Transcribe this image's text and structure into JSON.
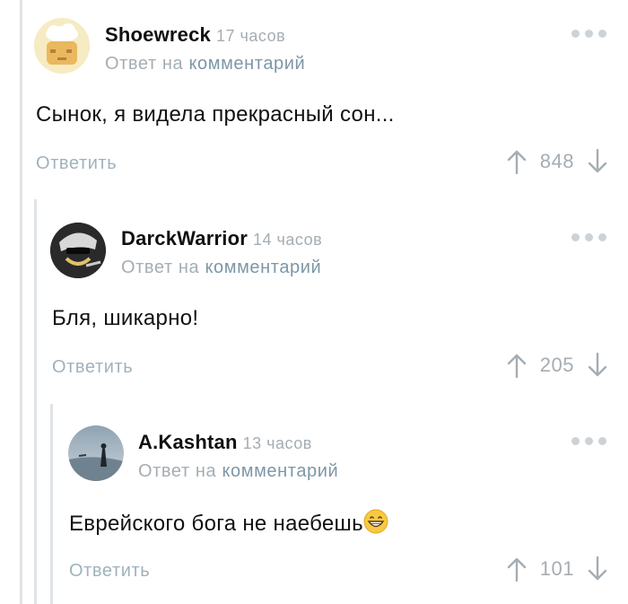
{
  "comments": [
    {
      "author": "Shoewreck",
      "time": "17 часов",
      "reply_prefix": "Ответ на",
      "reply_link": "комментарий",
      "text": "Сынок, я видела прекрасный сон...",
      "reply_label": "Ответить",
      "score": "848"
    },
    {
      "author": "DarckWarrior",
      "time": "14 часов",
      "reply_prefix": "Ответ на",
      "reply_link": "комментарий",
      "text": "Бля, шикарно!",
      "reply_label": "Ответить",
      "score": "205"
    },
    {
      "author": "A.Kashtan",
      "time": "13 часов",
      "reply_prefix": "Ответ на",
      "reply_link": "комментарий",
      "text": "Еврейского бога не наебешь",
      "reply_label": "Ответить",
      "score": "101"
    }
  ],
  "icons": {
    "upvote": "arrow-up-icon",
    "downvote": "arrow-down-icon",
    "more": "more-dots-icon",
    "emoji": "grinning-emoji-icon"
  },
  "colors": {
    "muted": "#a5adb3",
    "link": "#7d97a6",
    "thread_line": "#dfe3e6"
  }
}
